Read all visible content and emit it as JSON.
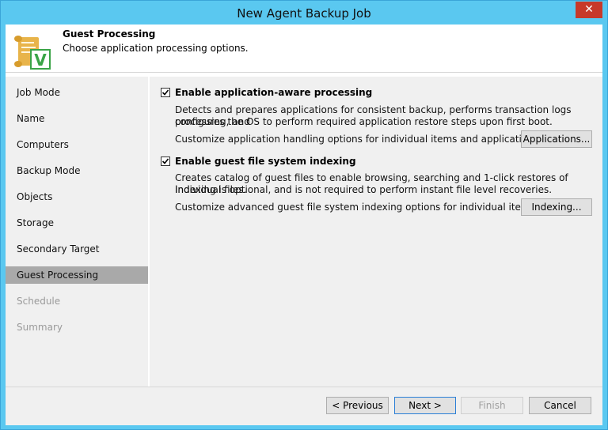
{
  "window": {
    "title": "New Agent Backup Job",
    "close_glyph": "✕"
  },
  "header": {
    "title": "Guest Processing",
    "subtitle": "Choose application processing options.",
    "icon": "scroll-checkmark-icon",
    "icon_letter": "V"
  },
  "sidebar": {
    "items": [
      {
        "label": "Job Mode",
        "state": "normal"
      },
      {
        "label": "Name",
        "state": "normal"
      },
      {
        "label": "Computers",
        "state": "normal"
      },
      {
        "label": "Backup Mode",
        "state": "normal"
      },
      {
        "label": "Objects",
        "state": "normal"
      },
      {
        "label": "Storage",
        "state": "normal"
      },
      {
        "label": "Secondary Target",
        "state": "normal"
      },
      {
        "label": "Guest Processing",
        "state": "active"
      },
      {
        "label": "Schedule",
        "state": "disabled"
      },
      {
        "label": "Summary",
        "state": "disabled"
      }
    ]
  },
  "main": {
    "app_aware": {
      "checked": true,
      "label": "Enable application-aware processing",
      "desc_line1": "Detects and prepares applications for consistent backup, performs transaction logs processing, and",
      "desc_line2": "configures the OS to perform required application restore steps upon first boot.",
      "customize": "Customize application handling options for individual items and applications",
      "button": "Applications..."
    },
    "indexing": {
      "checked": true,
      "label": "Enable guest file system indexing",
      "desc_line1": "Creates catalog of guest files to enable browsing, searching and 1-click restores of individual files.",
      "desc_line2": "Indexing is optional, and is not required to perform instant file level recoveries.",
      "customize": "Customize advanced guest file system indexing options for individual items",
      "button": "Indexing..."
    }
  },
  "footer": {
    "previous": "< Previous",
    "next": "Next >",
    "finish": "Finish",
    "cancel": "Cancel"
  },
  "colors": {
    "titlebar": "#5ac8f0",
    "close": "#c7392a",
    "sidebar_active": "#a9a9a9",
    "icon_green": "#3aa447",
    "icon_scroll": "#e8b44a"
  }
}
